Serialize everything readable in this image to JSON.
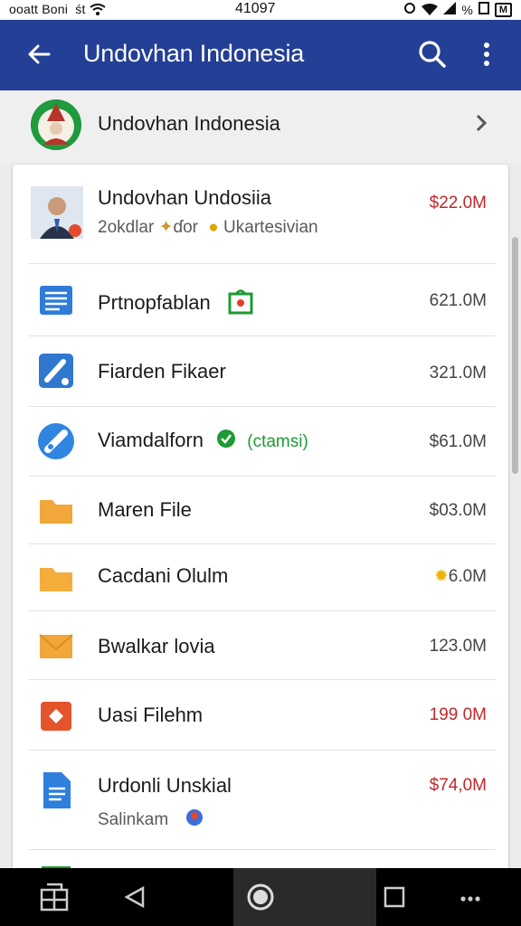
{
  "status_bar": {
    "left_text": "ooatt Boni",
    "left_extra": "śt",
    "center_text": "41097",
    "right_text": "%",
    "battery": "M"
  },
  "app_bar": {
    "title": "Undovhan Indonesia",
    "color": "#233f96"
  },
  "account": {
    "name": "Undovhan Indonesia"
  },
  "items": [
    {
      "label": "Undovhan Undosiia",
      "sub_a": "2okdlar",
      "sub_b": "ɗor",
      "sub_c": "Ukartesivian",
      "size": "$22.0M",
      "size_color": "red",
      "icon": "user-photo-icon"
    },
    {
      "label": "Prtnopfablan",
      "size": "621.0M",
      "icon": "document-lines-icon"
    },
    {
      "label": "Fiarden Fikaer",
      "size": "321.0M",
      "icon": "pencil-edit-icon"
    },
    {
      "label": "Viamdalforn",
      "tag": "(ctamsi)",
      "size": "$61.0M",
      "icon": "link-tool-icon"
    },
    {
      "label": "Maren File",
      "size": "$03.0M",
      "icon": "folder-icon"
    },
    {
      "label": "Cacdani Olulm",
      "size": "6.0M",
      "icon": "folder-icon"
    },
    {
      "label": "Bwalkar lovia",
      "size": "123.0M",
      "icon": "folder-icon"
    },
    {
      "label": "Uasi Filehm",
      "size": "199 0M",
      "size_color": "red",
      "icon": "shield-orange-icon"
    },
    {
      "label": "Urdonli Unskial",
      "sub_a": "Salinkam",
      "size": "$74,0M",
      "size_color": "red",
      "icon": "doc-blue-icon"
    }
  ]
}
